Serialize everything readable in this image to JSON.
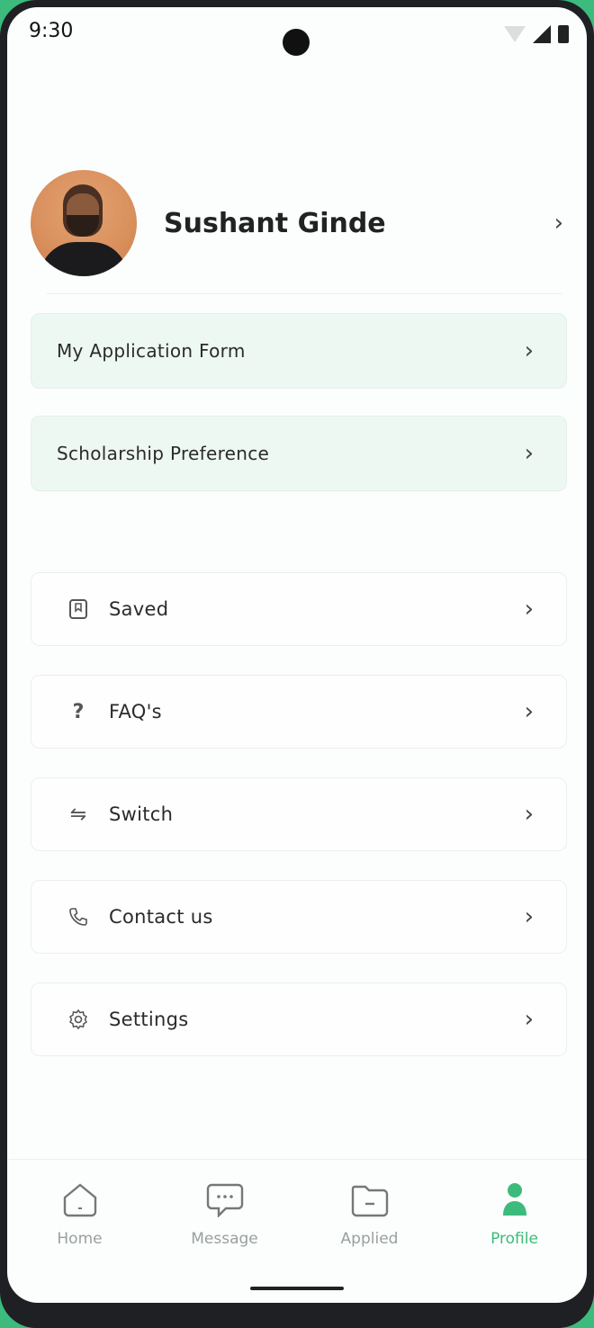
{
  "status_bar": {
    "time": "9:30"
  },
  "profile": {
    "name": "Sushant Ginde"
  },
  "highlight_cards": [
    {
      "label": "My Application Form"
    },
    {
      "label": "Scholarship Preference"
    }
  ],
  "menu": [
    {
      "label": "Saved",
      "icon": "bookmark-icon"
    },
    {
      "label": "FAQ's",
      "icon": "question-icon"
    },
    {
      "label": "Switch",
      "icon": "switch-arrows-icon"
    },
    {
      "label": "Contact us",
      "icon": "phone-icon"
    },
    {
      "label": "Settings",
      "icon": "gear-icon"
    }
  ],
  "bottom_nav": [
    {
      "label": "Home",
      "icon": "home-icon",
      "active": false
    },
    {
      "label": "Message",
      "icon": "message-icon",
      "active": false
    },
    {
      "label": "Applied",
      "icon": "folder-icon",
      "active": false
    },
    {
      "label": "Profile",
      "icon": "profile-icon",
      "active": true
    }
  ],
  "colors": {
    "accent": "#3dbb7c",
    "highlight_bg": "#edf8f2"
  }
}
